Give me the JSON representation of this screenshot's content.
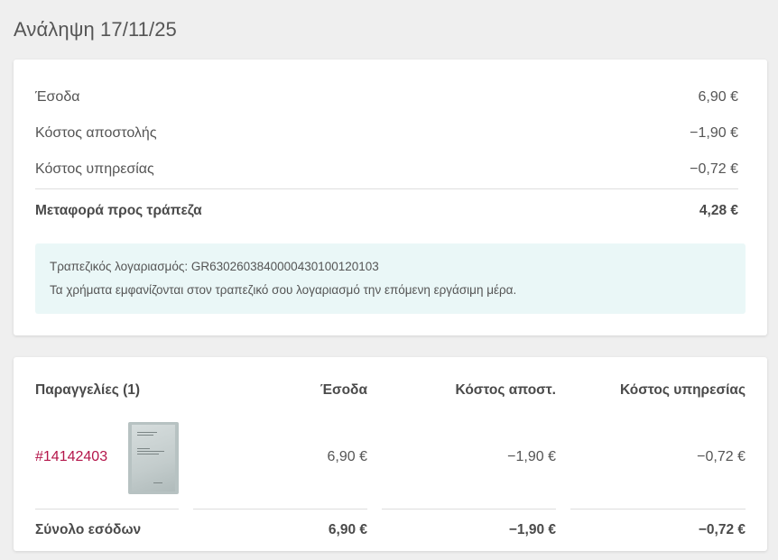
{
  "page": {
    "title": "Ανάληψη 17/11/25"
  },
  "summary": {
    "rows": [
      {
        "label": "Έσοδα",
        "value": "6,90 €"
      },
      {
        "label": "Κόστος αποστολής",
        "value": "−1,90 €"
      },
      {
        "label": "Κόστος υπηρεσίας",
        "value": "−0,72 €"
      }
    ],
    "total": {
      "label": "Μεταφορά προς τράπεζα",
      "value": "4,28 €"
    },
    "info": {
      "account_line": "Τραπεζικός λογαριασμός: GR6302603840000430100120103",
      "note": "Τα χρήματα εμφανίζονται στον τραπεζικό σου λογαριασμό την επόμενη εργάσιμη μέρα."
    }
  },
  "orders": {
    "headers": {
      "orders": "Παραγγελίες (1)",
      "income": "Έσοδα",
      "shipping": "Κόστος αποστ.",
      "service": "Κόστος υπηρεσίας"
    },
    "items": [
      {
        "id": "#14142403",
        "income": "6,90 €",
        "shipping": "−1,90 €",
        "service": "−0,72 €"
      }
    ],
    "footer": {
      "label": "Σύνολο εσόδων",
      "income": "6,90 €",
      "shipping": "−1,90 €",
      "service": "−0,72 €"
    }
  },
  "colors": {
    "background": "#efefef",
    "card": "#ffffff",
    "link": "#b4154a",
    "info_box": "#eaf7f7"
  }
}
